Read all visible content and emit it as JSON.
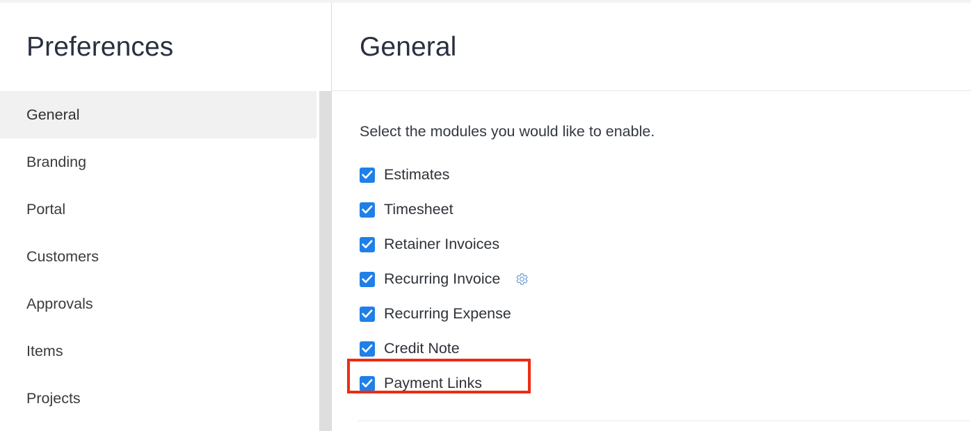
{
  "sidebar": {
    "title": "Preferences",
    "items": [
      {
        "label": "General",
        "selected": true
      },
      {
        "label": "Branding",
        "selected": false
      },
      {
        "label": "Portal",
        "selected": false
      },
      {
        "label": "Customers",
        "selected": false
      },
      {
        "label": "Approvals",
        "selected": false
      },
      {
        "label": "Items",
        "selected": false
      },
      {
        "label": "Projects",
        "selected": false
      }
    ]
  },
  "content": {
    "title": "General",
    "description": "Select the modules you would like to enable.",
    "modules": [
      {
        "label": "Estimates",
        "checked": true,
        "gear": false,
        "highlighted": false
      },
      {
        "label": "Timesheet",
        "checked": true,
        "gear": false,
        "highlighted": false
      },
      {
        "label": "Retainer Invoices",
        "checked": true,
        "gear": false,
        "highlighted": false
      },
      {
        "label": "Recurring Invoice",
        "checked": true,
        "gear": true,
        "highlighted": false
      },
      {
        "label": "Recurring Expense",
        "checked": true,
        "gear": false,
        "highlighted": false
      },
      {
        "label": "Credit Note",
        "checked": true,
        "gear": false,
        "highlighted": false
      },
      {
        "label": "Payment Links",
        "checked": true,
        "gear": false,
        "highlighted": true
      }
    ]
  },
  "colors": {
    "checkbox_blue": "#1e80e8",
    "highlight_red": "#ee2c12",
    "selected_row_bg": "#f1f1f1",
    "gear_blue": "#6d9fd6",
    "heading_text": "#2a3040"
  },
  "icons": {
    "gear": "gear-icon",
    "check": "check-icon"
  }
}
